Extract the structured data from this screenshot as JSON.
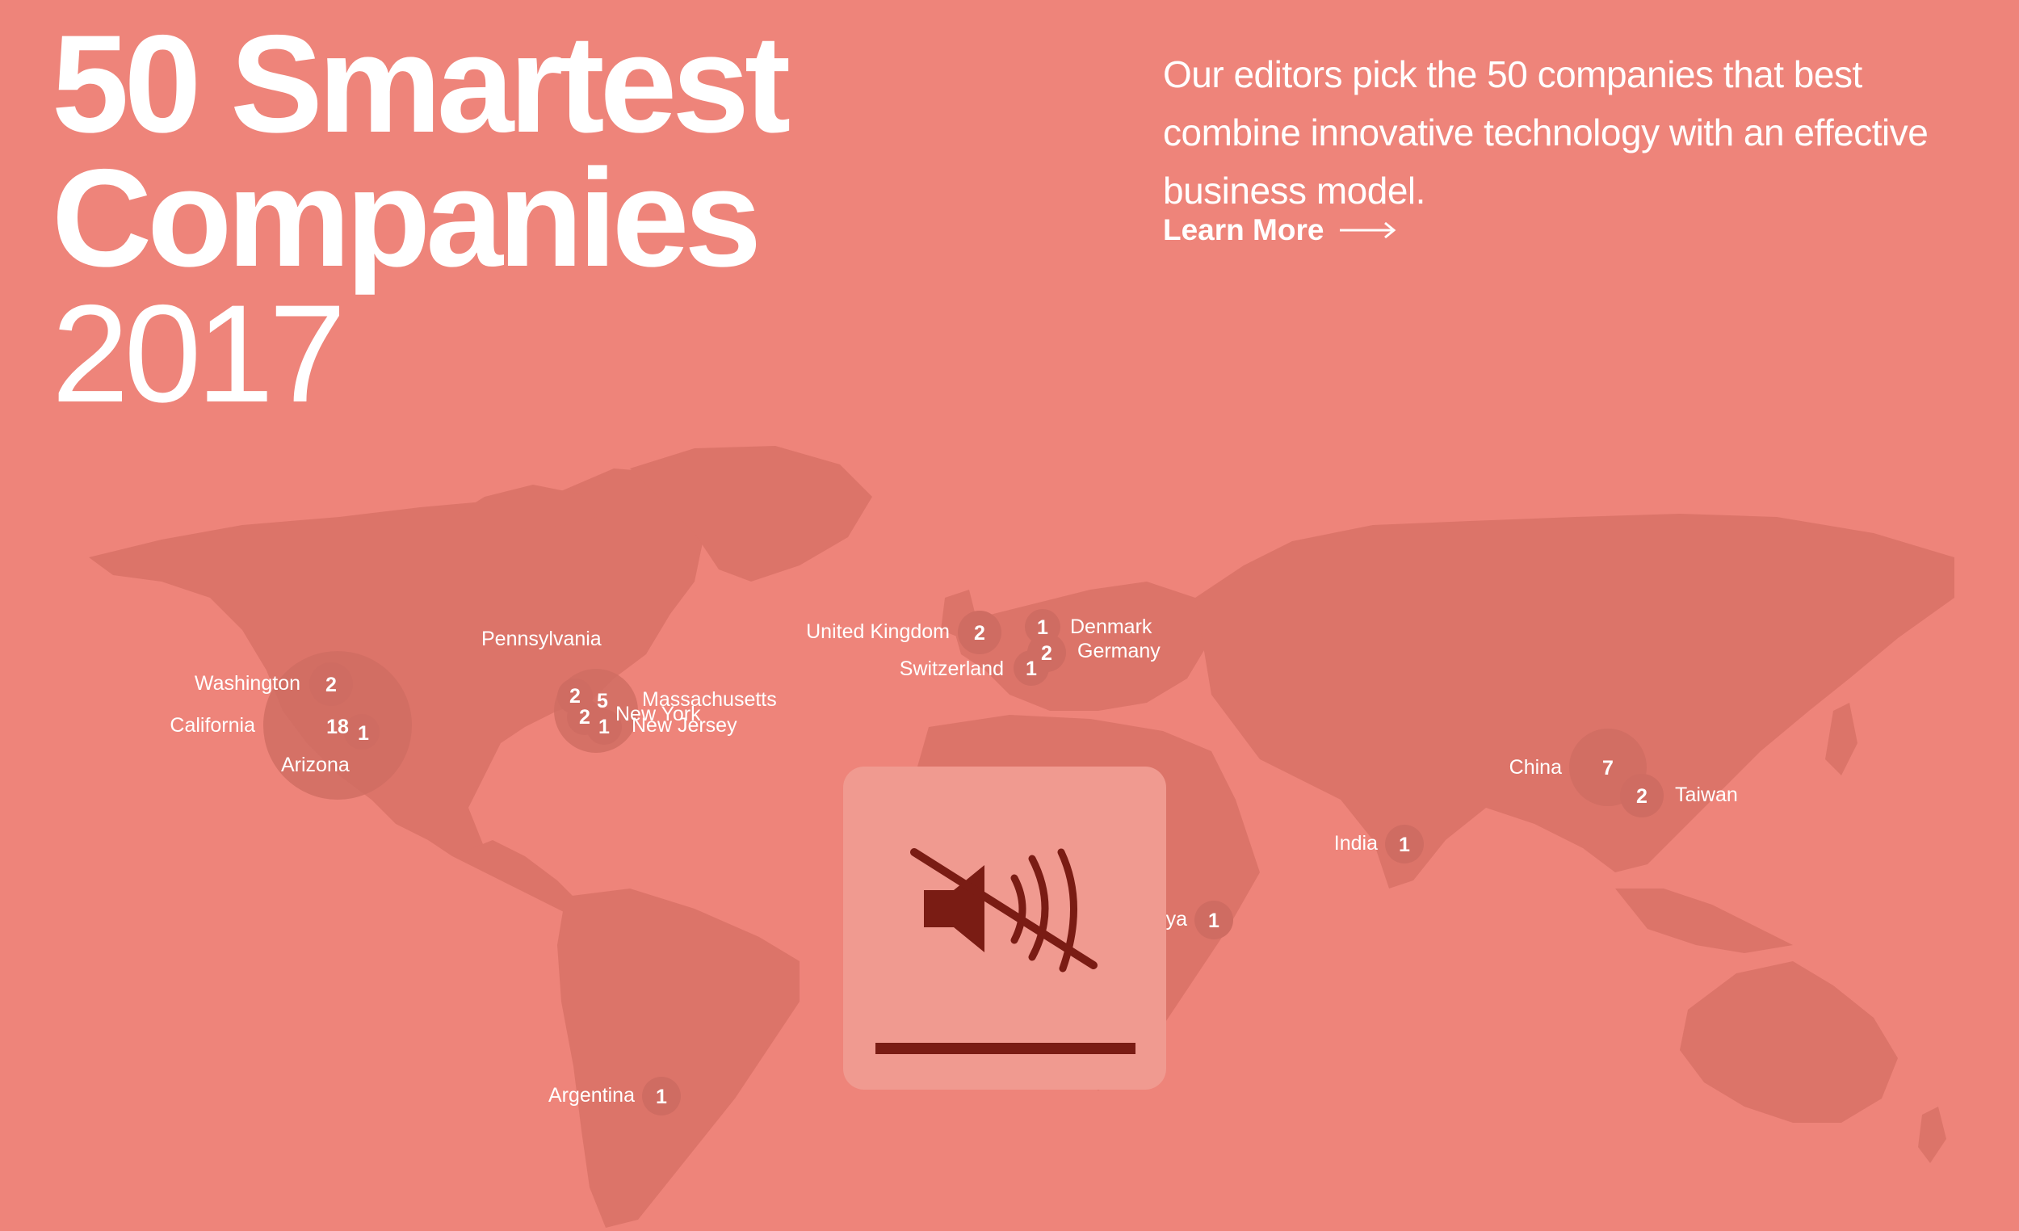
{
  "header": {
    "title_line1": "50 Smartest",
    "title_line2": "Companies",
    "title_line3": "2017",
    "description": "Our editors pick the 50 companies that best combine innovative technology with an effective business model.",
    "learn_more": "Learn More",
    "learn_more_icon": "arrow-right-icon"
  },
  "colors": {
    "background": "#ee847a",
    "land": "#dc7469",
    "bubble": "#cf6c62",
    "overlay": "#f09a90",
    "overlay_icon": "#7a1c14"
  },
  "map": {
    "locations": [
      {
        "name": "Washington",
        "count": "2"
      },
      {
        "name": "California",
        "count": "18"
      },
      {
        "name": "Arizona",
        "count": "1"
      },
      {
        "name": "Pennsylvania",
        "count": "2"
      },
      {
        "name": "Massachusetts",
        "count": "5"
      },
      {
        "name": "New York",
        "count": "2"
      },
      {
        "name": "New Jersey",
        "count": "1"
      },
      {
        "name": "United Kingdom",
        "count": "2"
      },
      {
        "name": "Denmark",
        "count": "1"
      },
      {
        "name": "Germany",
        "count": "2"
      },
      {
        "name": "Switzerland",
        "count": "1"
      },
      {
        "name": "China",
        "count": "7"
      },
      {
        "name": "Taiwan",
        "count": "2"
      },
      {
        "name": "India",
        "count": "1"
      },
      {
        "name": "ya",
        "count": "1"
      },
      {
        "name": "Argentina",
        "count": "1"
      }
    ]
  },
  "media_overlay": {
    "icon": "speaker-muted-icon"
  }
}
